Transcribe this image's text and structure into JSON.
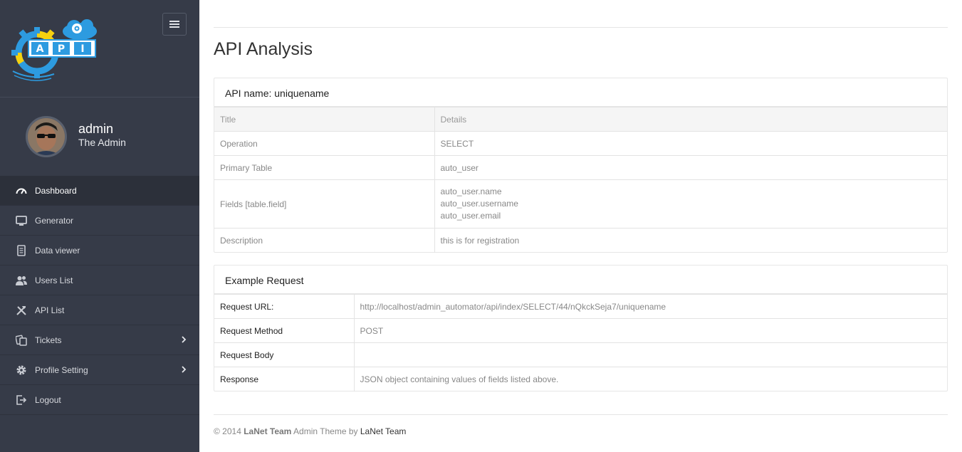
{
  "logo": {
    "letters": [
      "A",
      "P",
      "I"
    ]
  },
  "user": {
    "name": "admin",
    "role": "The Admin"
  },
  "nav": [
    {
      "label": "Dashboard",
      "icon": "speedometer-icon"
    },
    {
      "label": "Generator",
      "icon": "monitor-icon"
    },
    {
      "label": "Data viewer",
      "icon": "document-icon"
    },
    {
      "label": "Users List",
      "icon": "users-icon"
    },
    {
      "label": "API List",
      "icon": "tools-icon"
    },
    {
      "label": "Tickets",
      "icon": "tickets-icon"
    },
    {
      "label": "Profile Setting",
      "icon": "gear-icon"
    },
    {
      "label": "Logout",
      "icon": "logout-icon"
    }
  ],
  "page": {
    "title": "API Analysis"
  },
  "api_panel": {
    "heading": "API name: uniquename",
    "columns": [
      "Title",
      "Details"
    ],
    "rows": {
      "operation": {
        "title": "Operation",
        "details": "SELECT"
      },
      "primary_table": {
        "title": "Primary Table",
        "details": "auto_user"
      },
      "fields": {
        "title": "Fields [table.field]",
        "details": [
          "auto_user.name",
          "auto_user.username",
          "auto_user.email"
        ]
      },
      "description": {
        "title": "Description",
        "details": "this is for registration"
      }
    }
  },
  "example_panel": {
    "heading": "Example Request",
    "rows": {
      "url": {
        "label": "Request URL:",
        "value": "http://localhost/admin_automator/api/index/SELECT/44/nQkckSeja7/uniquename"
      },
      "method": {
        "label": "Request Method",
        "value": "POST"
      },
      "body": {
        "label": "Request Body",
        "value": ""
      },
      "response": {
        "label": "Response",
        "value": "JSON object containing values of fields listed above."
      }
    }
  },
  "footer": {
    "copyright": "© 2014",
    "brand": "LaNet Team",
    "middle": "Admin Theme by",
    "link": "LaNet Team"
  },
  "colors": {
    "sidebar": "#363b48",
    "sidebar_active": "#2c303a",
    "logo_blue": "#2d9be0",
    "logo_yellow": "#f5d10f"
  }
}
